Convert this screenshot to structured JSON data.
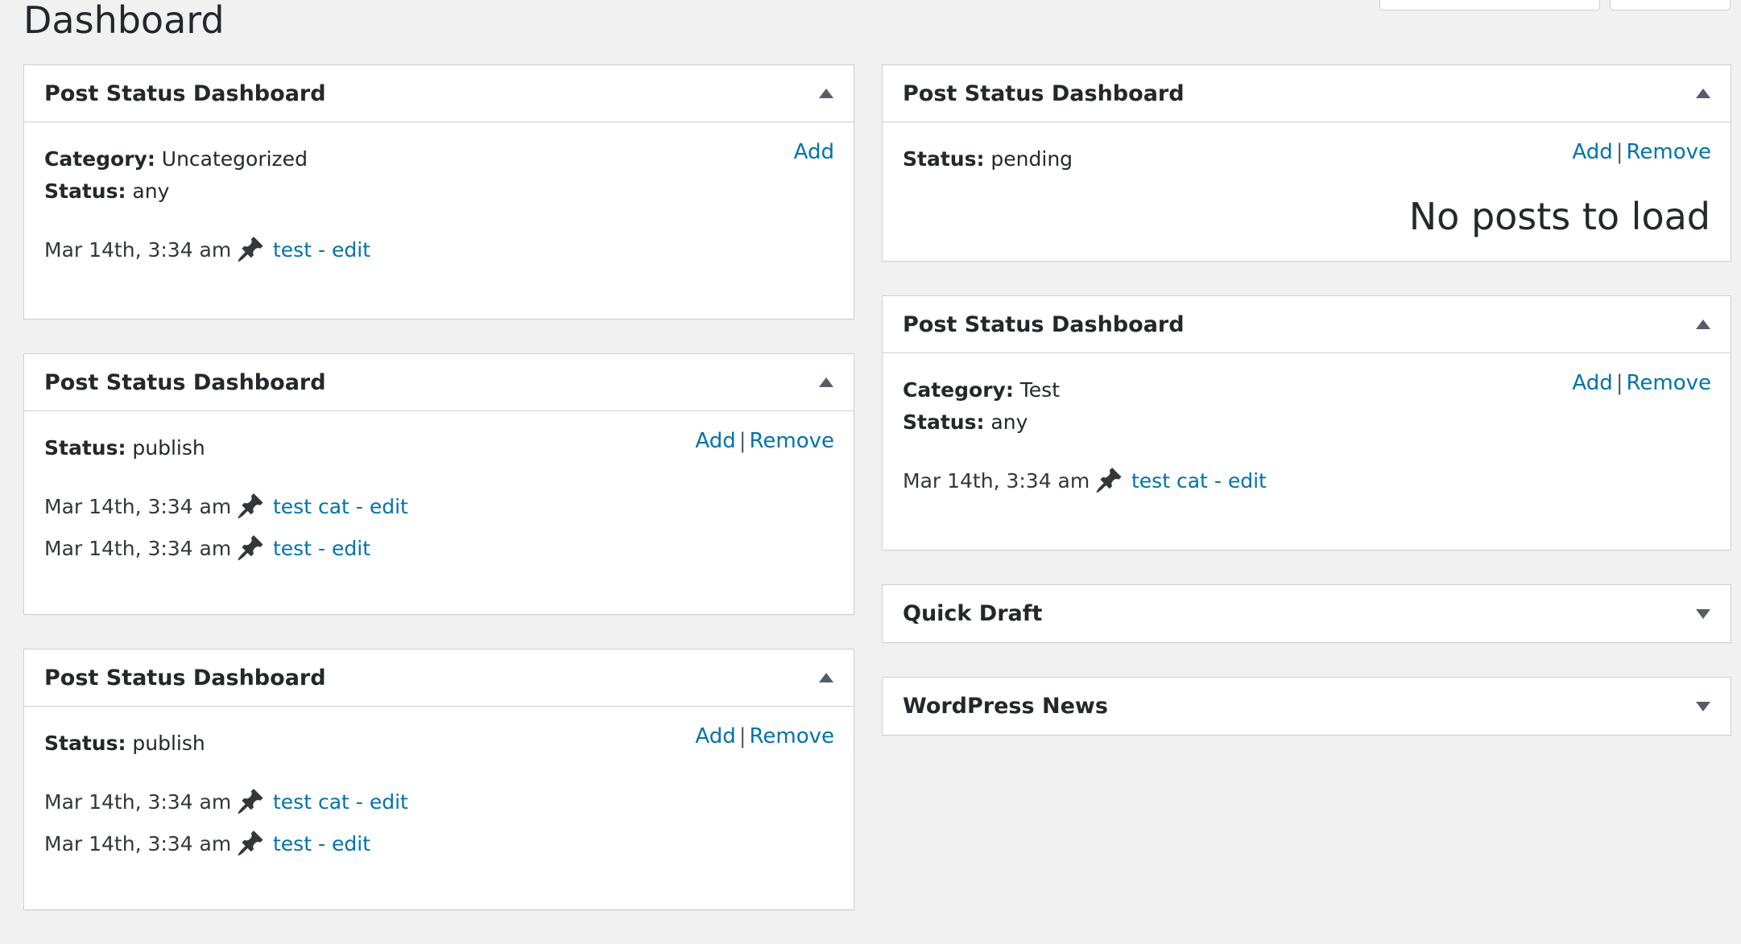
{
  "page": {
    "title": "Dashboard"
  },
  "colors": {
    "link": "#0073aa",
    "background": "#f1f1f1",
    "border": "#ccd0d4"
  },
  "left_column": [
    {
      "title": "Post Status Dashboard",
      "toggle": "up",
      "meta": [
        {
          "label": "Category:",
          "value": "Uncategorized"
        },
        {
          "label": "Status:",
          "value": "any"
        }
      ],
      "actions": {
        "add": "Add"
      },
      "posts": [
        {
          "date": "Mar 14th, 3:34 am",
          "title": "test",
          "dash": "-",
          "edit": "edit"
        }
      ]
    },
    {
      "title": "Post Status Dashboard",
      "toggle": "up",
      "meta": [
        {
          "label": "Status:",
          "value": "publish"
        }
      ],
      "actions": {
        "add": "Add",
        "separator": "|",
        "remove": "Remove"
      },
      "posts": [
        {
          "date": "Mar 14th, 3:34 am",
          "title": "test cat",
          "dash": "-",
          "edit": "edit"
        },
        {
          "date": "Mar 14th, 3:34 am",
          "title": "test",
          "dash": "-",
          "edit": "edit"
        }
      ]
    },
    {
      "title": "Post Status Dashboard",
      "toggle": "up",
      "meta": [
        {
          "label": "Status:",
          "value": "publish"
        }
      ],
      "actions": {
        "add": "Add",
        "separator": "|",
        "remove": "Remove"
      },
      "posts": [
        {
          "date": "Mar 14th, 3:34 am",
          "title": "test cat",
          "dash": "-",
          "edit": "edit"
        },
        {
          "date": "Mar 14th, 3:34 am",
          "title": "test",
          "dash": "-",
          "edit": "edit"
        }
      ]
    }
  ],
  "right_column": [
    {
      "title": "Post Status Dashboard",
      "toggle": "up",
      "meta": [
        {
          "label": "Status:",
          "value": "pending"
        }
      ],
      "actions": {
        "add": "Add",
        "separator": "|",
        "remove": "Remove"
      },
      "empty_message": "No posts to load"
    },
    {
      "title": "Post Status Dashboard",
      "toggle": "up",
      "meta": [
        {
          "label": "Category:",
          "value": "Test"
        },
        {
          "label": "Status:",
          "value": "any"
        }
      ],
      "actions": {
        "add": "Add",
        "separator": "|",
        "remove": "Remove"
      },
      "posts": [
        {
          "date": "Mar 14th, 3:34 am",
          "title": "test cat",
          "dash": "-",
          "edit": "edit"
        }
      ]
    },
    {
      "title": "Quick Draft",
      "toggle": "down"
    },
    {
      "title": "WordPress News",
      "toggle": "down"
    }
  ],
  "icons": {
    "post_status": "pushpin-icon",
    "collapse": "triangle-up-icon",
    "expand": "triangle-down-icon"
  }
}
